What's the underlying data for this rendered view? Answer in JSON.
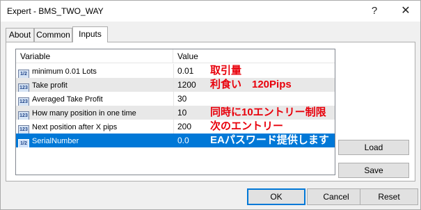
{
  "window": {
    "title": "Expert - BMS_TWO_WAY",
    "help_glyph": "?",
    "close_glyph": "✕"
  },
  "tabs": [
    {
      "label": "About"
    },
    {
      "label": "Common"
    },
    {
      "label": "Inputs",
      "active": true
    }
  ],
  "grid": {
    "headers": {
      "variable": "Variable",
      "value": "Value"
    },
    "rows": [
      {
        "type_icon": "1/2",
        "name": "minimum 0.01 Lots",
        "value": "0.01",
        "note": "取引量",
        "selected": false
      },
      {
        "type_icon": "123",
        "name": "Take profit",
        "value": "1200",
        "note": "利食い　120Pips",
        "selected": false
      },
      {
        "type_icon": "123",
        "name": "Averaged Take Profit",
        "value": "30",
        "note": "",
        "selected": false
      },
      {
        "type_icon": "123",
        "name": "How many position in one time",
        "value": "10",
        "note": "同時に10エントリー制限",
        "selected": false
      },
      {
        "type_icon": "123",
        "name": "Next position after X pips",
        "value": "200",
        "note": "次のエントリー",
        "selected": false
      },
      {
        "type_icon": "1/2",
        "name": "SerialNumber",
        "value": "0.0",
        "note": "EAパスワード提供します",
        "selected": true
      }
    ]
  },
  "side_buttons": {
    "load": "Load",
    "save": "Save"
  },
  "footer": {
    "ok": "OK",
    "cancel": "Cancel",
    "reset": "Reset"
  },
  "colors": {
    "selection": "#0078d7",
    "note_text": "#e8000b"
  }
}
